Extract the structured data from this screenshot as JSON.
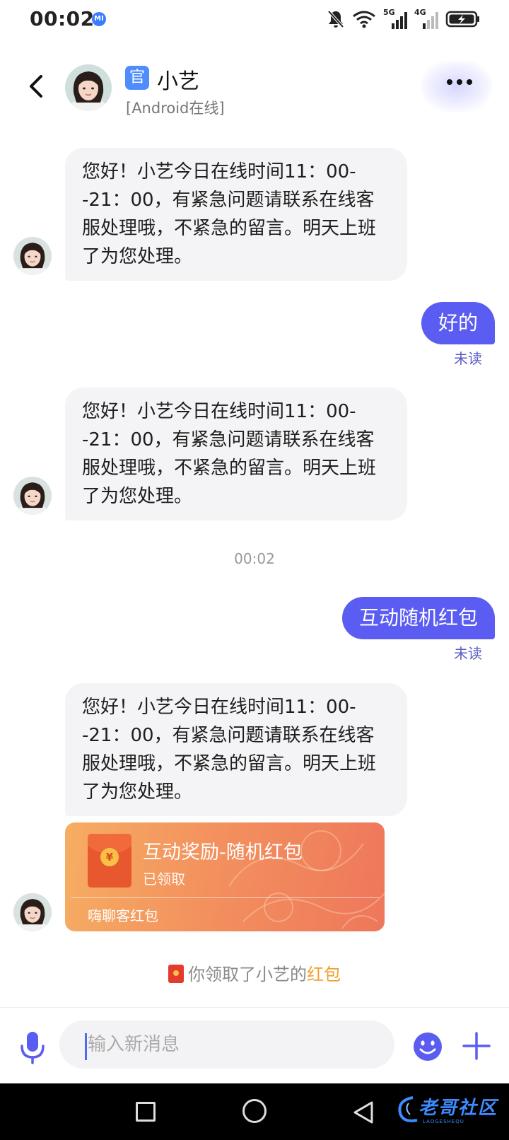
{
  "status_bar": {
    "time": "00:02",
    "mi_badge": "MI",
    "signal_5g": "5G",
    "signal_4g": "4G"
  },
  "header": {
    "official_badge": "官",
    "contact_name": "小艺",
    "contact_status": "[Android在线]"
  },
  "messages": [
    {
      "type": "incoming",
      "text": "您好！小艺今日在线时间11：00--21：00，有紧急问题请联系在线客服处理哦，不紧急的留言。明天上班了为您处理。"
    },
    {
      "type": "outgoing",
      "text": "好的",
      "status": "未读"
    },
    {
      "type": "incoming",
      "text": "您好！小艺今日在线时间11：00--21：00，有紧急问题请联系在线客服处理哦，不紧急的留言。明天上班了为您处理。"
    },
    {
      "type": "time",
      "text": "00:02"
    },
    {
      "type": "outgoing",
      "text": "互动随机红包",
      "status": "未读"
    },
    {
      "type": "incoming",
      "text": "您好！小艺今日在线时间11：00--21：00，有紧急问题请联系在线客服处理哦，不紧急的留言。明天上班了为您处理。"
    }
  ],
  "red_packet": {
    "title": "互动奖励-随机红包",
    "status": "已领取",
    "footer": "嗨聊客红包",
    "coin_symbol": "¥"
  },
  "system_message": {
    "prefix": "你领取了小艺的",
    "highlight": "红包"
  },
  "input_bar": {
    "placeholder": "输入新消息"
  },
  "watermark": {
    "text": "老哥社区",
    "sub": "LAOGESHEQU"
  },
  "colors": {
    "accent": "#5b5cf2",
    "incoming_bubble": "#f4f4f6",
    "read_status": "#5a5cc8",
    "red_packet_start": "#f6ad63",
    "red_packet_end": "#ee775b",
    "highlight": "#f0a030"
  },
  "icons": {
    "back": "chevron-left-icon",
    "more": "more-dots-icon",
    "mic": "microphone-icon",
    "emoji": "emoji-smile-icon",
    "plus": "plus-icon",
    "dnd": "bell-off-icon",
    "wifi": "wifi-icon",
    "battery": "battery-charging-icon"
  }
}
